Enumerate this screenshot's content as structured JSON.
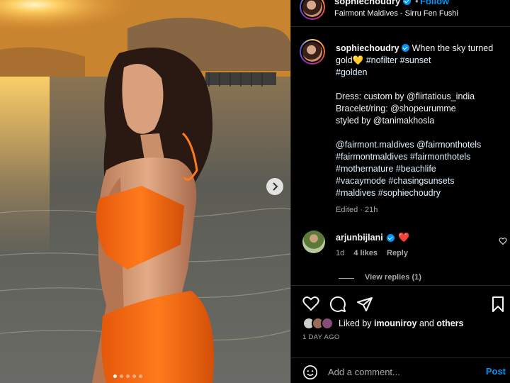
{
  "post": {
    "username": "sophiechoudry",
    "follow_label": "Follow",
    "separator": "•",
    "location": "Fairmont Maldives - Sirru Fen Fushi",
    "carousel": {
      "slides": 5,
      "active_index": 0
    }
  },
  "caption": {
    "username": "sophiechoudry",
    "lines": [
      "When the sky turned gold💛",
      "#nofilter #sunset",
      "#golden",
      "",
      "Dress: custom by @flirtatious_india",
      "Bracelet/ring: @shopeurumme",
      "styled by @tanimakhosla",
      "",
      "@fairmont.maldives @fairmonthotels",
      "#fairmontmaldives #fairmonthotels",
      "#mothernature #beachlife",
      "#vacaymode #chasingsunsets",
      "#maldives #sophiechoudry"
    ],
    "edited": "Edited · 21h"
  },
  "comment": {
    "username": "arjunbijlani",
    "text": "❤️",
    "time": "1d",
    "likes": "4 likes",
    "reply": "Reply",
    "view_replies": "View replies (1)"
  },
  "likes": {
    "liked_by_prefix": "Liked by",
    "liked_by_user": "imouniroy",
    "and": "and",
    "others": "others",
    "date": "1 DAY AGO"
  },
  "add_comment": {
    "placeholder": "Add a comment...",
    "post_label": "Post"
  },
  "colors": {
    "accent": "#0095f6",
    "heart": "#ff3040",
    "muted": "#a8a8a8",
    "dress": "#f26a10"
  }
}
